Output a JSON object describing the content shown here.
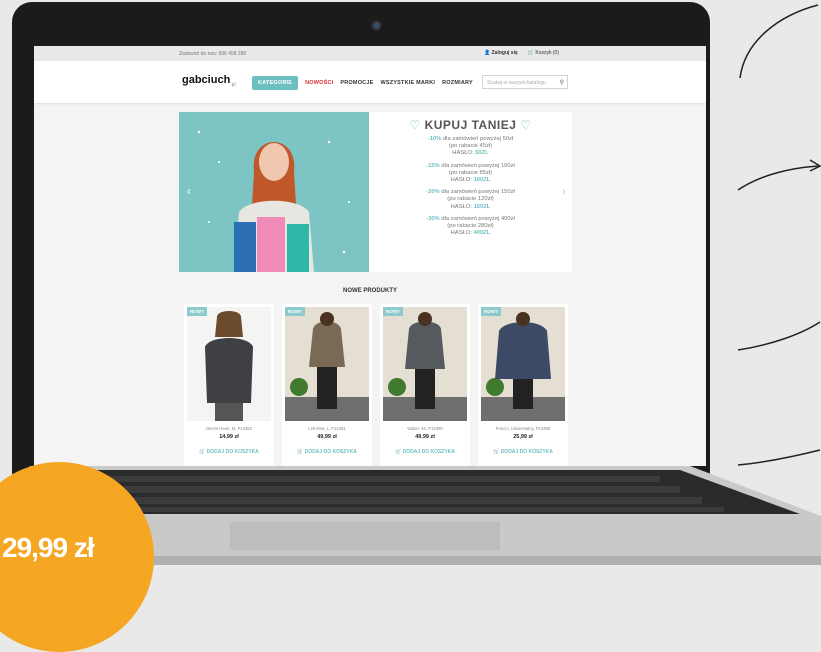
{
  "site": {
    "call_text": "Zadzwoń do nas: 696 458 280",
    "login": "Zaloguj się",
    "cart": "Koszyk (0)",
    "logo": "gabciuch",
    "logo_suffix": ".pl",
    "nav": [
      "KATEGORIE",
      "NOWOŚCI",
      "PROMOCJE",
      "WSZYSTKIE MARKI",
      "ROZMIARY"
    ],
    "search_placeholder": "Szukaj w naszym katalogu"
  },
  "banner": {
    "title": "KUPUJ TANIEJ",
    "offers": [
      {
        "pct": "-10%",
        "text": "dla zamówień powyżej 50zł",
        "discount": "(po rabacie 45zł)",
        "label": "HASŁO:",
        "code": "50ZL"
      },
      {
        "pct": "-15%",
        "text": "dla zamówień powyżej 100zł",
        "discount": "(po rabacie 85zł)",
        "label": "HASŁO:",
        "code": "100ZL"
      },
      {
        "pct": "-20%",
        "text": "dla zamówień powyżej 150zł",
        "discount": "(po rabacie 120zł)",
        "label": "HASŁO:",
        "code": "150ZL"
      },
      {
        "pct": "-30%",
        "text": "dla zamówień powyżej 400zł",
        "discount": "(po rabacie 280zł)",
        "label": "HASŁO:",
        "code": "400ZL"
      }
    ]
  },
  "products": {
    "title": "NOWE PRODUKTY",
    "items": [
      {
        "tag": "NOWY",
        "name": "Denim Heart, M, P14362",
        "price": "14,99 zł",
        "add": "DODAJ DO KOSZYKA",
        "color": "#3e4044"
      },
      {
        "tag": "NOWY",
        "name": "Lett Kiss, L, P14361",
        "price": "49,99 zł",
        "add": "DODAJ DO KOSZYKA",
        "color": "#7a6a55"
      },
      {
        "tag": "NOWY",
        "name": "Walter, 40, P14360",
        "price": "49,99 zł",
        "add": "DODAJ DO KOSZYKA",
        "color": "#555a5e"
      },
      {
        "tag": "NOWY",
        "name": "Poncio, Uniwersalny, P14358",
        "price": "25,99 zł",
        "add": "DODAJ DO KOSZYKA",
        "color": "#3d4a66"
      }
    ]
  },
  "badge": {
    "price": "29,99 zł"
  }
}
